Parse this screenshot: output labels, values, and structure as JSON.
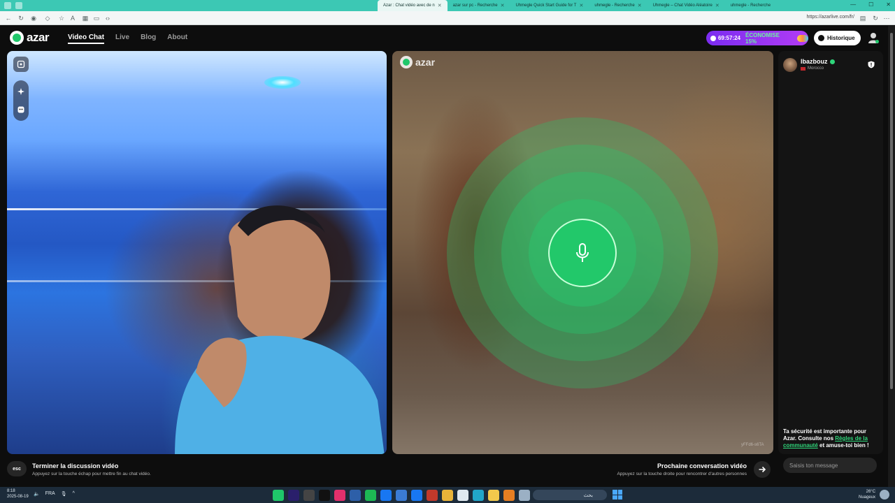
{
  "browser": {
    "tabs": [
      {
        "label": "Azar : Chat vidéo avec de n",
        "active": true
      },
      {
        "label": "azar sur pc - Recherche",
        "active": false
      },
      {
        "label": "Uhmegle Quick Start Guide for T",
        "active": false
      },
      {
        "label": "uhmegle - Recherche",
        "active": false
      },
      {
        "label": "Uhmegle – Chat Vidéo Aléatoire",
        "active": false
      },
      {
        "label": "uhmegle - Recherche",
        "active": false
      }
    ],
    "url": "https://azarlive.com/fr/"
  },
  "header": {
    "logo_text": "azar",
    "nav": [
      {
        "label": "Video Chat",
        "active": true
      },
      {
        "label": "Live",
        "active": false
      },
      {
        "label": "Blog",
        "active": false
      },
      {
        "label": "About",
        "active": false
      }
    ],
    "timer": "69:57:24",
    "promo": "ÉCONOMISE 15%",
    "history_label": "Historique"
  },
  "video": {
    "right_logo_text": "azar",
    "partner_id": "yFFd6-s6TA"
  },
  "side": {
    "username": "lbazbouz",
    "country": "Morocco",
    "safety_text_1": "Ta sécurité est importante pour Azar. Consulte nos ",
    "safety_link": "Règles de la communauté",
    "safety_text_2": " et amuse-toi bien !",
    "message_placeholder": "Saisis ton message"
  },
  "controls": {
    "esc_label": "esc",
    "end_title": "Terminer la discussion vidéo",
    "end_subtitle": "Appuyez sur la touche échap pour mettre fin au chat vidéo.",
    "next_title": "Prochaine conversation vidéo",
    "next_subtitle": "Appuyez sur la touche droite pour rencontrer d'autres personnes"
  },
  "taskbar": {
    "time": "8:18",
    "date": "2025-08-19",
    "lang": "FRA",
    "search_text": "بحث",
    "weather_temp": "26°C",
    "weather_desc": "Nuageux"
  },
  "colors": {
    "accent_green": "#1fc76a",
    "promo_purple": "#9b34f2",
    "tab_bar": "#3cc8b4"
  }
}
